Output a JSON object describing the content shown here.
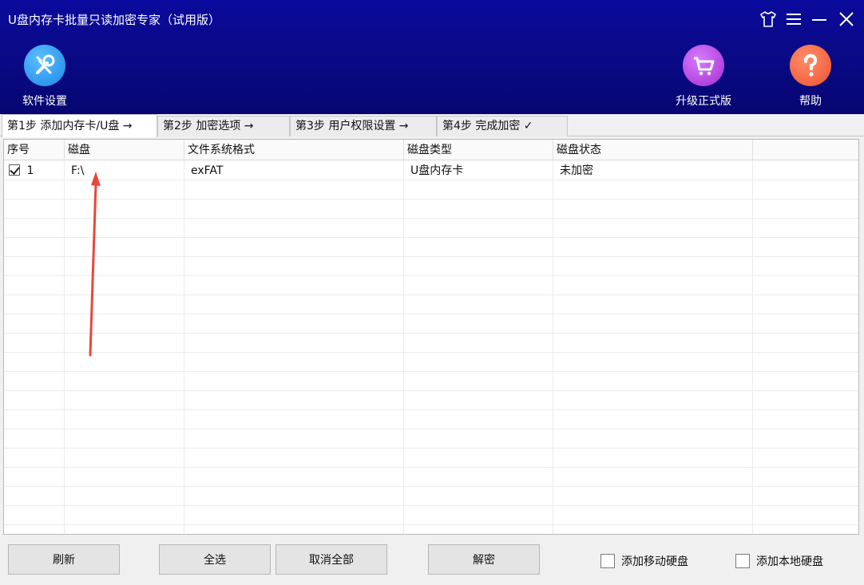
{
  "window": {
    "title": "U盘内存卡批量只读加密专家（试用版）"
  },
  "toolbar": {
    "settings_label": "软件设置",
    "upgrade_label": "升级正式版",
    "help_label": "帮助"
  },
  "tabs": [
    {
      "label": "第1步 添加内存卡/U盘 →",
      "active": true
    },
    {
      "label": "第2步 加密选项 →",
      "active": false
    },
    {
      "label": "第3步 用户权限设置 →",
      "active": false
    },
    {
      "label": "第4步 完成加密 ✓",
      "active": false
    }
  ],
  "table": {
    "columns": [
      "序号",
      "磁盘",
      "文件系统格式",
      "磁盘类型",
      "磁盘状态"
    ],
    "rows": [
      {
        "checked": true,
        "index": "1",
        "disk": "F:\\",
        "fs": "exFAT",
        "type": "U盘内存卡",
        "status": "未加密"
      }
    ]
  },
  "buttons": {
    "refresh": "刷新",
    "select_all": "全选",
    "cancel_all": "取消全部",
    "decrypt": "解密"
  },
  "options": {
    "add_removable": "添加移动硬盘",
    "add_local": "添加本地硬盘"
  },
  "colors": {
    "header_bg": "#0a0a8a",
    "settings_icon": "#2196f3",
    "upgrade_icon": "#b23fd8",
    "help_icon": "#f4623a",
    "annotation_arrow": "#e8473a"
  }
}
